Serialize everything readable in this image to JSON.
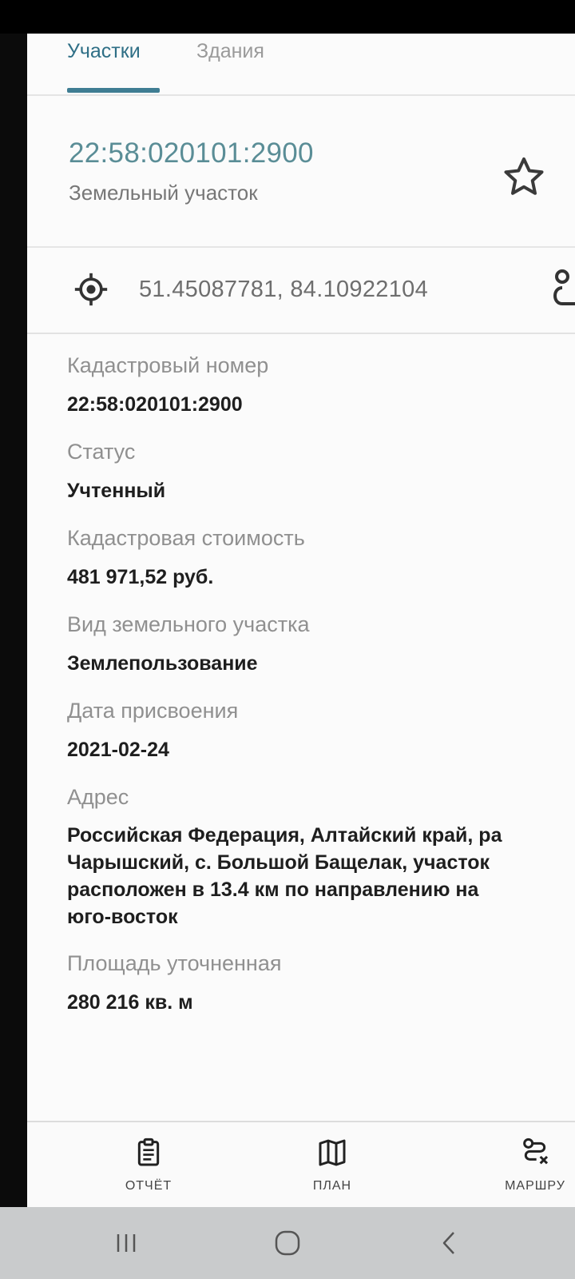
{
  "tabs": [
    {
      "label": "Участки",
      "active": true
    },
    {
      "label": "Здания",
      "active": false
    }
  ],
  "header": {
    "cadastral_number": "22:58:020101:2900",
    "object_type": "Земельный участок"
  },
  "location": {
    "coordinates": "51.45087781, 84.10922104"
  },
  "fields": [
    {
      "label": "Кадастровый номер",
      "value": "22:58:020101:2900"
    },
    {
      "label": "Статус",
      "value": "Учтенный"
    },
    {
      "label": "Кадастровая стоимость",
      "value": "481 971,52 руб."
    },
    {
      "label": "Вид земельного участка",
      "value": "Землепользование"
    },
    {
      "label": "Дата присвоения",
      "value": "2021-02-24"
    },
    {
      "label": "Адрес",
      "value_lines": [
        "Российская Федерация, Алтайский край, ра",
        "Чарышский, с. Большой Бащелак, участок",
        "расположен в 13.4 км по направлению на",
        "юго-восток"
      ]
    },
    {
      "label": "Площадь уточненная",
      "value": "280 216 кв. м"
    }
  ],
  "bottom_nav": [
    {
      "icon": "clipboard-icon",
      "label": "ОТЧЁТ"
    },
    {
      "icon": "map-icon",
      "label": "ПЛАН"
    },
    {
      "icon": "route-icon",
      "label": "МАРШРУ"
    }
  ],
  "colors": {
    "accent": "#3f7d93",
    "cadastral_title": "#5a8d96",
    "background": "#fbfbfb",
    "system_nav": "#c9cbcc"
  }
}
